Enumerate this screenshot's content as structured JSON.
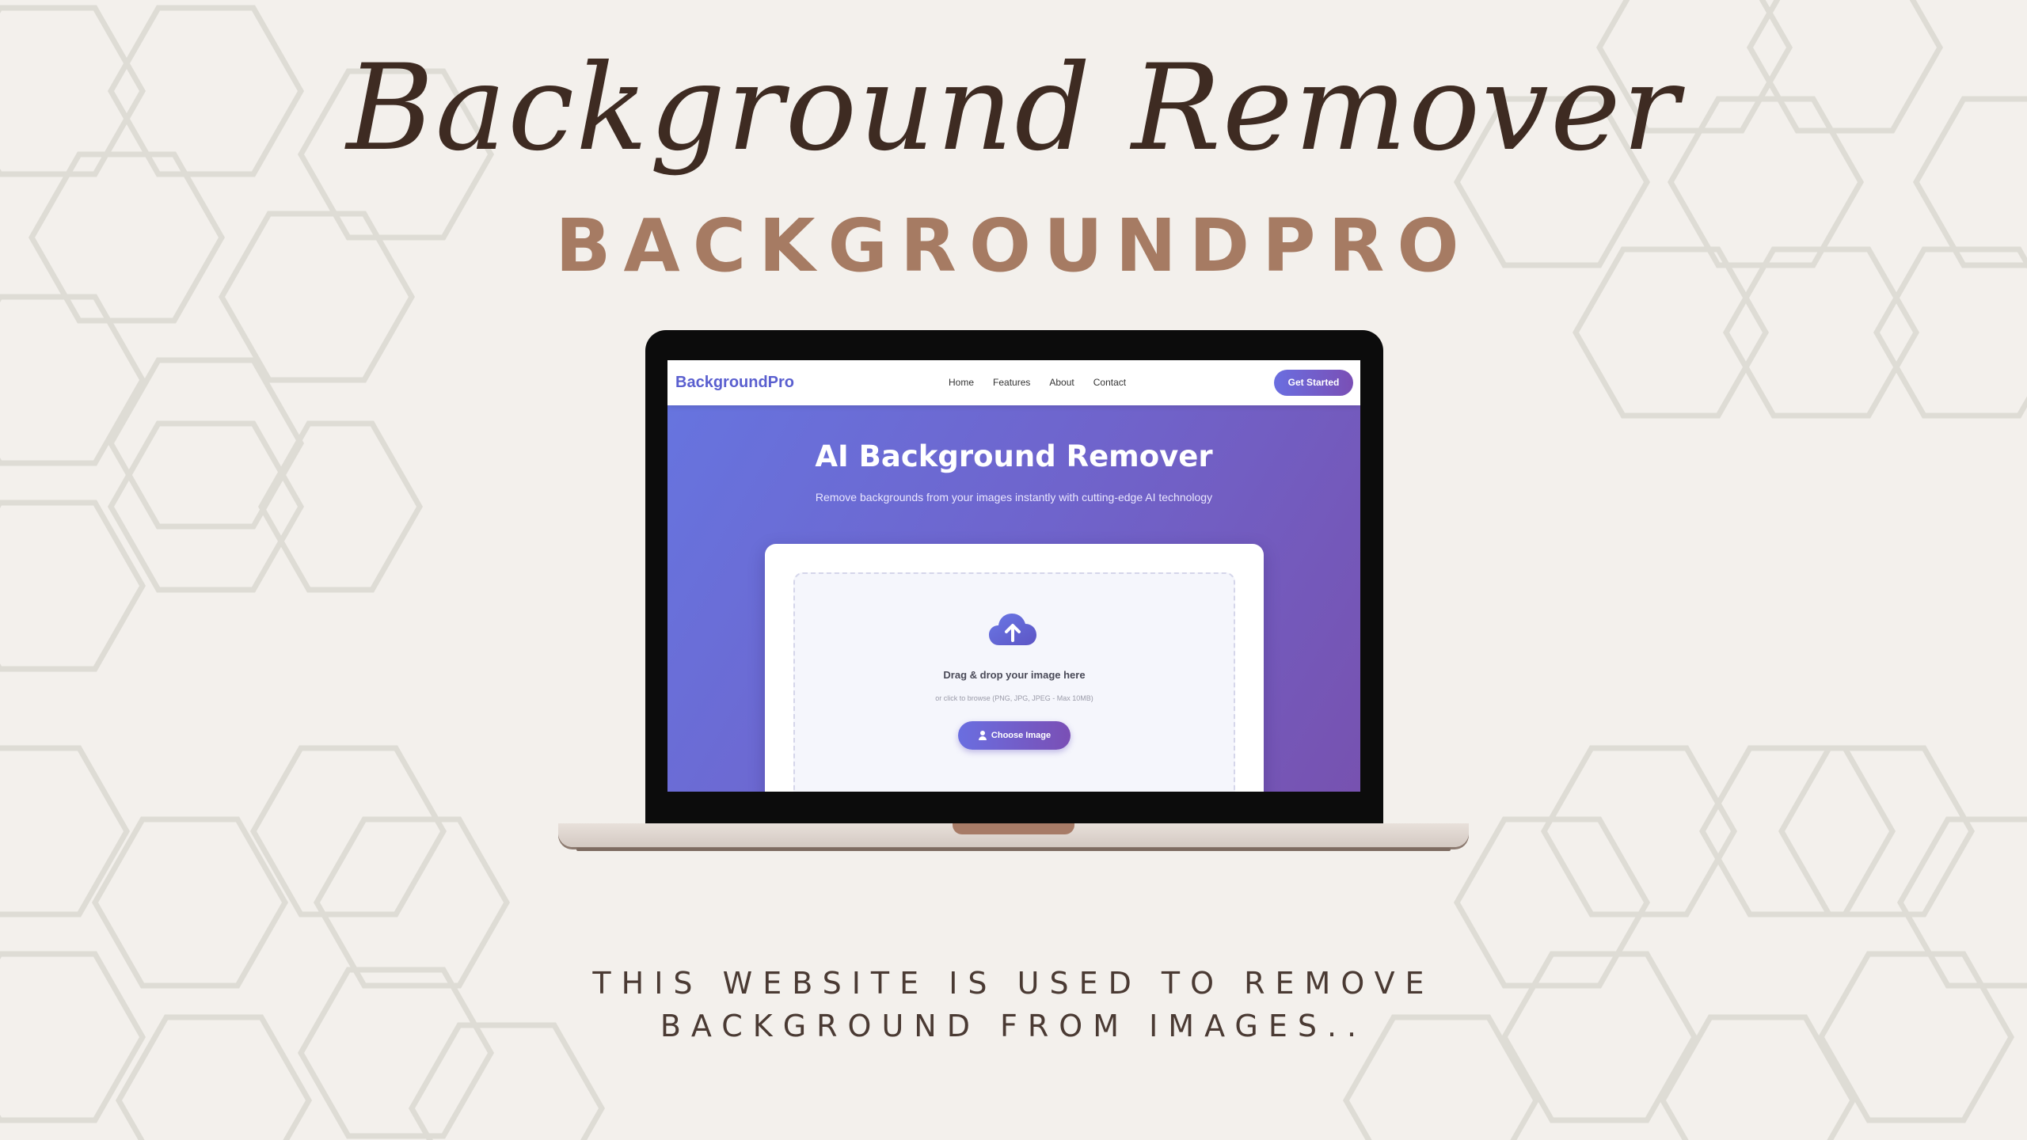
{
  "page": {
    "script_title": "Background Remover",
    "brand_title": "BACKGROUNDPRO",
    "tagline_line1": "THIS WEBSITE IS USED TO REMOVE",
    "tagline_line2": "BACKGROUND FROM IMAGES.."
  },
  "site": {
    "logo": "BackgroundPro",
    "nav": [
      "Home",
      "Features",
      "About",
      "Contact"
    ],
    "cta_label": "Get Started",
    "hero_title": "AI Background Remover",
    "hero_subtitle": "Remove backgrounds from your images instantly with cutting-edge AI technology",
    "upload": {
      "title": "Drag & drop your image here",
      "hint": "or click to browse (PNG, JPG, JPEG - Max 10MB)",
      "button_label": "Choose Image",
      "icon": "cloud-upload-icon"
    }
  },
  "colors": {
    "page_background": "#f3f0ec",
    "script_title": "#3e2b22",
    "brand_title": "#a67b63",
    "tagline": "#4a3a33",
    "hexagon_lines": "#dedcd5",
    "hero_gradient_start": "#6675e0",
    "hero_gradient_end": "#7752b0",
    "accent": "#5a5fcf",
    "laptop_notch": "#a77b67"
  }
}
